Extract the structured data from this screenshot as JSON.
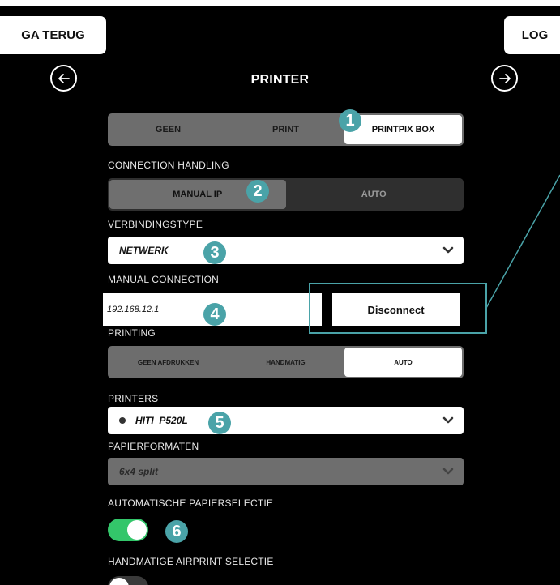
{
  "header": {
    "back_label": "GA TERUG",
    "log_label": "LOG",
    "title": "PRINTER",
    "prev_icon": "arrow-left-icon",
    "next_icon": "arrow-right-icon"
  },
  "print_mode": {
    "options": [
      "GEEN",
      "PRINT",
      "PRINTPIX BOX"
    ],
    "selected": "PRINTPIX BOX"
  },
  "connection_handling": {
    "label": "CONNECTION HANDLING",
    "options": [
      "MANUAL IP",
      "AUTO"
    ],
    "selected": "MANUAL IP"
  },
  "connection_type": {
    "label": "VERBINDINGSTYPE",
    "value": "NETWERK"
  },
  "manual_connection": {
    "label": "MANUAL CONNECTION",
    "ip_value": "192.168.12.1",
    "disconnect_label": "Disconnect"
  },
  "printing": {
    "label": "PRINTING",
    "options": [
      "GEEN AFDRUKKEN",
      "HANDMATIG",
      "AUTO"
    ],
    "selected": "AUTO"
  },
  "printers": {
    "label": "PRINTERS",
    "value": "HITI_P520L"
  },
  "paper_formats": {
    "label": "PAPIERFORMATEN",
    "value": "6x4 split"
  },
  "auto_paper": {
    "label": "AUTOMATISCHE PAPIERSELECTIE",
    "enabled": true
  },
  "airprint": {
    "label": "HANDMATIGE AIRPRINT SELECTIE",
    "enabled": false
  },
  "badges": [
    "1",
    "2",
    "3",
    "4",
    "5",
    "6"
  ],
  "colors": {
    "accent": "#4aa3a8",
    "toggle_on": "#33c66a",
    "background": "#000000"
  }
}
